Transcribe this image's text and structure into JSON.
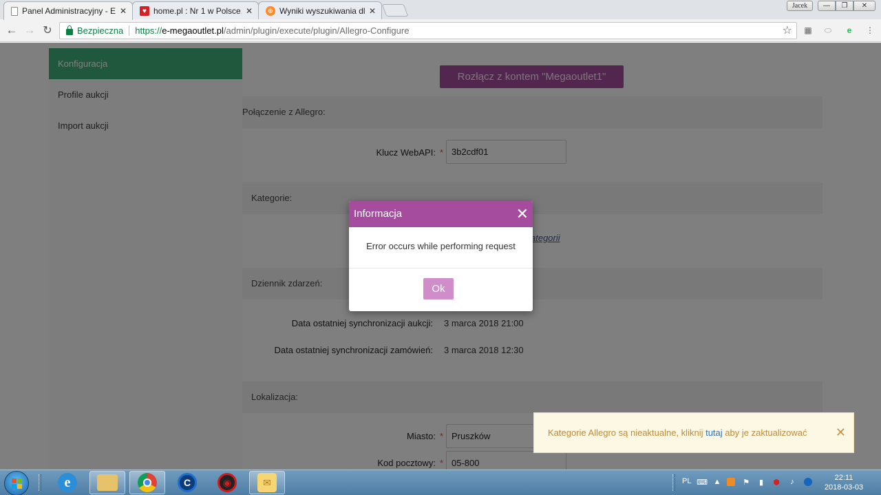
{
  "browser": {
    "tabs": [
      {
        "title": "Panel Administracyjny - E",
        "favicon": "page-icon",
        "active": true
      },
      {
        "title": "home.pl : Nr 1 w Polsce.",
        "favicon": "home-pl-icon",
        "active": false
      },
      {
        "title": "Wyniki wyszukiwania dla",
        "favicon": "search-results-icon",
        "active": false
      }
    ],
    "user_badge": "Jacek",
    "security_label": "Bezpieczna",
    "url": {
      "scheme": "https://",
      "host": "e-megaoutlet.pl",
      "path": "/admin/plugin/execute/plugin/Allegro-Configure"
    }
  },
  "sidebar": {
    "items": [
      {
        "label": "Konfiguracja",
        "active": true
      },
      {
        "label": "Profile aukcji",
        "active": false
      },
      {
        "label": "Import aukcji",
        "active": false
      }
    ]
  },
  "main": {
    "disconnect_button": "Rozłącz z kontem \"Megaoutlet1\"",
    "sections": {
      "connection": "Połączenie z Allegro:",
      "categories": "Kategorie:",
      "log": "Dziennik zdarzeń:",
      "location": "Lokalizacja:"
    },
    "webapi_label": "Klucz WebAPI:",
    "webapi_value": "3b2cdf01",
    "required_mark": "*",
    "categories_link_partial": "ategorii",
    "log": {
      "auction_sync_label": "Data ostatniej synchronizacji aukcji:",
      "auction_sync_value": "3 marca 2018 21:00",
      "orders_sync_label": "Data ostatniej synchronizacji zamówień:",
      "orders_sync_value": "3 marca 2018 12:30"
    },
    "city_label": "Miasto:",
    "city_value": "Pruszków",
    "postal_label": "Kod pocztowy:",
    "postal_value": "05-800"
  },
  "modal": {
    "title": "Informacja",
    "close_glyph": "✕",
    "message": "Error occurs while performing request",
    "ok_button": "Ok"
  },
  "toast": {
    "text_before": "Kategorie Allegro są nieaktualne, kliknij ",
    "link": "tutaj",
    "text_after": " aby je zaktualizować",
    "close_glyph": "✕"
  },
  "taskbar": {
    "language": "PL",
    "time": "22:11",
    "date": "2018-03-03",
    "pinned": [
      "internet-explorer-icon",
      "file-explorer-icon",
      "chrome-icon",
      "ccleaner-icon",
      "red-app-icon",
      "outlook-icon"
    ]
  },
  "colors": {
    "accent_green": "#40b17a",
    "accent_purple": "#a64c9e",
    "toast_bg": "#fcf8e3",
    "toast_text": "#bd8a3b"
  }
}
